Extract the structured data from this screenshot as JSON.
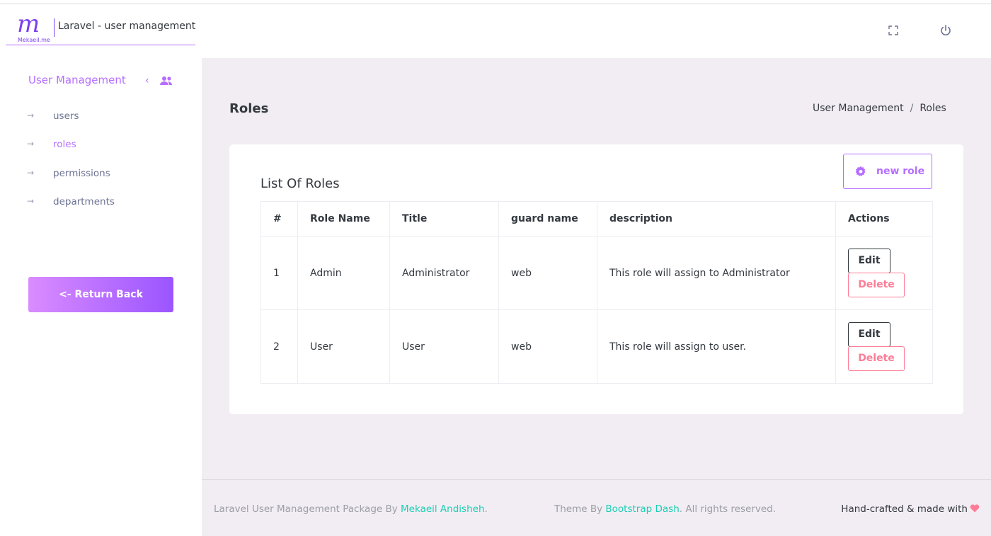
{
  "app": {
    "logo_letter": "m",
    "logo_caption": "Mekaeil.me",
    "title": "Laravel - user management"
  },
  "navbar": {
    "icons": [
      "fullscreen-icon",
      "power-icon"
    ]
  },
  "sidebar": {
    "heading": "User Management",
    "collapse_glyph": "‹",
    "items": [
      {
        "label": "users",
        "active": false
      },
      {
        "label": "roles",
        "active": true
      },
      {
        "label": "permissions",
        "active": false
      },
      {
        "label": "departments",
        "active": false
      }
    ],
    "return_button": "<- Return Back"
  },
  "page": {
    "title": "Roles",
    "breadcrumb": [
      "User Management",
      "Roles"
    ],
    "breadcrumb_separator": "/"
  },
  "card": {
    "title": "List Of Roles",
    "new_button": "new role",
    "columns": [
      "#",
      "Role Name",
      "Title",
      "guard name",
      "description",
      "Actions"
    ],
    "rows": [
      {
        "num": "1",
        "name": "Admin",
        "title": "Administrator",
        "guard": "web",
        "description": "This role will assign to Administrator",
        "edit": "Edit",
        "delete": "Delete"
      },
      {
        "num": "2",
        "name": "User",
        "title": "User",
        "guard": "web",
        "description": "This role will assign to user.",
        "edit": "Edit",
        "delete": "Delete"
      }
    ]
  },
  "footer": {
    "left_prefix": "Laravel User Management Package By ",
    "left_link": "Mekaeil Andisheh",
    "left_suffix": ".",
    "mid_prefix": "Theme By ",
    "mid_link": "Bootstrap Dash",
    "mid_suffix": ". All rights reserved.",
    "right": "Hand-crafted & made with"
  },
  "colors": {
    "accent": "#b66dff",
    "danger": "#fe7c96",
    "link": "#1bcfb4",
    "page_bg": "#f2edf3"
  }
}
